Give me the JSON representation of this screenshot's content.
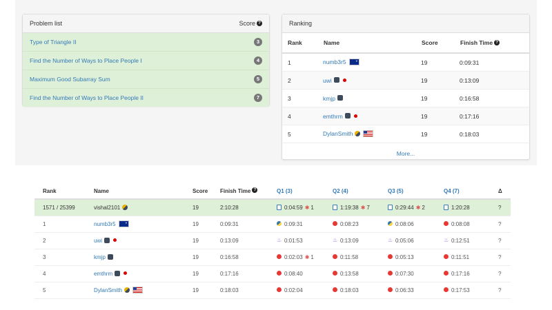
{
  "problem_list": {
    "title": "Problem list",
    "score_label": "Score",
    "items": [
      {
        "name": "Type of Triangle II",
        "score": "3"
      },
      {
        "name": "Find the Number of Ways to Place People I",
        "score": "4"
      },
      {
        "name": "Maximum Good Subarray Sum",
        "score": "5"
      },
      {
        "name": "Find the Number of Ways to Place People II",
        "score": "7"
      }
    ]
  },
  "ranking": {
    "title": "Ranking",
    "columns": {
      "rank": "Rank",
      "name": "Name",
      "score": "Score",
      "finish": "Finish Time"
    },
    "rows": [
      {
        "rank": "1",
        "name": "numb3r5",
        "score": "19",
        "finish": "0:09:31"
      },
      {
        "rank": "2",
        "name": "uwi",
        "score": "19",
        "finish": "0:13:09"
      },
      {
        "rank": "3",
        "name": "kmjp",
        "score": "19",
        "finish": "0:16:58"
      },
      {
        "rank": "4",
        "name": "emthrm",
        "score": "19",
        "finish": "0:17:16"
      },
      {
        "rank": "5",
        "name": "DylanSmith",
        "score": "19",
        "finish": "0:18:03"
      }
    ],
    "more": "More..."
  },
  "board": {
    "columns": {
      "rank": "Rank",
      "name": "Name",
      "score": "Score",
      "finish": "Finish Time",
      "q1": "Q1 (3)",
      "q2": "Q2 (4)",
      "q3": "Q3 (5)",
      "q4": "Q4 (7)",
      "delta": "Δ"
    },
    "me": {
      "rank": "1571 / 25399",
      "name": "vishal2101",
      "score": "19",
      "finish": "2:10:28",
      "q1": "0:04:59",
      "q1_bugs": "1",
      "q2": "1:19:38",
      "q2_bugs": "7",
      "q3": "0:29:44",
      "q3_bugs": "2",
      "q4": "1:20:28",
      "delta": "?"
    },
    "rows": [
      {
        "rank": "1",
        "name": "numb3r5",
        "score": "19",
        "finish": "0:09:31",
        "q1": "0:09:31",
        "q2": "0:08:23",
        "q3": "0:08:06",
        "q4": "0:08:08",
        "delta": "?"
      },
      {
        "rank": "2",
        "name": "uwi",
        "score": "19",
        "finish": "0:13:09",
        "q1": "0:01:53",
        "q2": "0:13:09",
        "q3": "0:05:06",
        "q4": "0:12:51",
        "delta": "?"
      },
      {
        "rank": "3",
        "name": "kmjp",
        "score": "19",
        "finish": "0:16:58",
        "q1": "0:02:03",
        "q1_bugs": "1",
        "q2": "0:11:58",
        "q3": "0:05:13",
        "q4": "0:11:51",
        "delta": "?"
      },
      {
        "rank": "4",
        "name": "emthrm",
        "score": "19",
        "finish": "0:17:16",
        "q1": "0:08:40",
        "q2": "0:13:58",
        "q3": "0:07:30",
        "q4": "0:17:16",
        "delta": "?"
      },
      {
        "rank": "5",
        "name": "DylanSmith",
        "score": "19",
        "finish": "0:18:03",
        "q1": "0:02:04",
        "q2": "0:18:03",
        "q3": "0:06:33",
        "q4": "0:17:53",
        "delta": "?"
      }
    ]
  },
  "icons": {
    "help": "question-circle-icon",
    "badge": "cube-icon",
    "online": "red-dot-icon",
    "doc": "document-icon",
    "bug": "bug-icon"
  },
  "colors": {
    "accepted_bg": "#dff0d8",
    "link": "#337ab7",
    "badge_bg": "#777777"
  }
}
